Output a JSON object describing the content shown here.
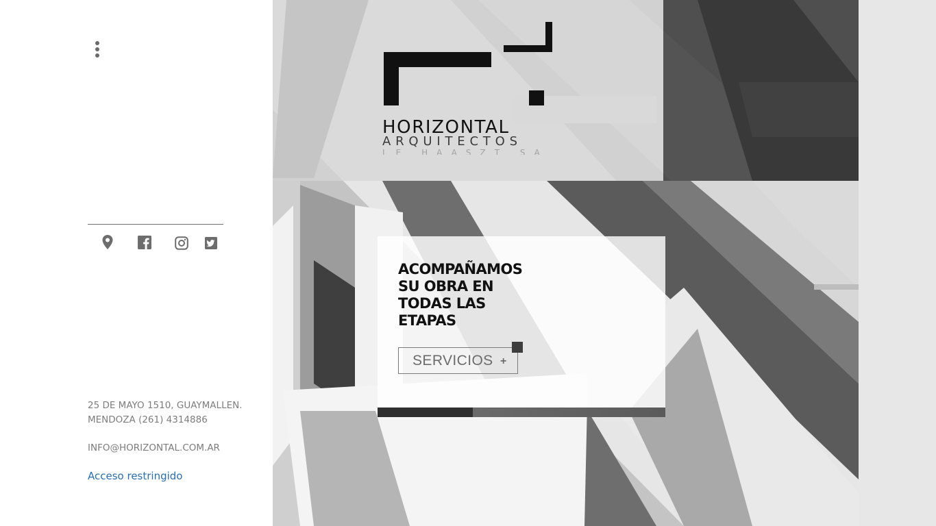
{
  "menu": {
    "icon": "kebab-menu-icon"
  },
  "social": [
    {
      "name": "location",
      "icon": "location-pin-icon"
    },
    {
      "name": "facebook",
      "icon": "facebook-icon"
    },
    {
      "name": "instagram",
      "icon": "instagram-icon"
    },
    {
      "name": "twitter",
      "icon": "twitter-icon"
    }
  ],
  "contact": {
    "address_line1": "25 DE MAYO 1510, GUAYMALLEN.",
    "address_line2": "MENDOZA (261) 4314886",
    "email": "INFO@HORIZONTAL.COM.AR",
    "restricted_link": "Acceso restringido"
  },
  "logo": {
    "word": "HORIZONTAL",
    "sub": "ARQUITECTOS",
    "sub2": "LE HAASZT SA"
  },
  "hero": {
    "headline": "ACOMPAÑAMOS SU OBRA EN TODAS LAS ETAPAS",
    "button_label": "SERVICIOS",
    "button_plus": "+",
    "slide_progress": 0.33
  },
  "colors": {
    "link": "#2a6fb4",
    "text_muted": "#7c7c7c",
    "dark_panel": "#3a3a3a",
    "right_strip": "#e7e7e7"
  }
}
